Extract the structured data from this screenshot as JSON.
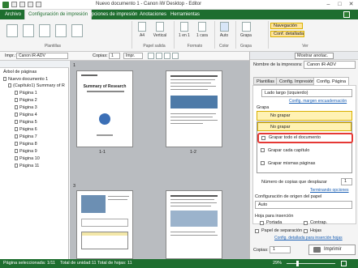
{
  "window": {
    "title": "Nuevo documento 1 - Canon iW Desktop - Editor"
  },
  "ribbon_tabs": [
    "Archivo",
    "Configuración de impresión",
    "Opciones de impresión",
    "Anotaciones",
    "Herramientas"
  ],
  "ribbon": {
    "plantillas_label": "Plantillas",
    "papel_salida_label": "Papel salida",
    "formato_label": "Formato",
    "color_label": "Color",
    "grapa_label": "Grapa",
    "ver_label": "Ver",
    "size_value": "A4",
    "orientation_value": "Vertical",
    "pages_per_sheet": "1 en 1",
    "sides": "1 cara",
    "color_value": "Auto",
    "grapa_value": "Grapa",
    "nav_button": "Navegación",
    "conf_detallada_button": "Conf. detallada",
    "mostrar_anotac_button": "Mostrar anotac."
  },
  "toolbar": {
    "printer_label": "Impr.:",
    "printer_value": "Canon iR-ADV",
    "copies_label": "Copias:",
    "copies_value": "1",
    "nav_value": "Impr."
  },
  "tree": {
    "header": "Árbol de páginas",
    "root": "Nuevo documento 1",
    "chapter": "(Capítulo1) Summary of R",
    "pages": [
      "Página 1",
      "Página 2",
      "Página 3",
      "Página 4",
      "Página 5",
      "Página 6",
      "Página 7",
      "Página 8",
      "Página 9",
      "Página 10",
      "Página 11"
    ]
  },
  "viewer": {
    "chapter_number": "1",
    "page_labels": [
      "1-1",
      "1-2"
    ],
    "second_row_number": "3",
    "page1_title": "Summary of Research"
  },
  "panel": {
    "printer_label": "Nombre de la impresora:",
    "printer_value": "Canon iR-ADV",
    "tabs": [
      "Plantillas",
      "Config. Impresión",
      "Config. Página"
    ],
    "binding_value": "Lado largo (izquierdo)",
    "margin_link": "Config. margen encuadernación",
    "grapa_label": "Grapa",
    "no_grapar_selected": "No grapar",
    "options": [
      "No grapar",
      "Grapar todo el documento",
      "Grapar cada capítulo",
      "Grapar mismas páginas"
    ],
    "copies_shift_label": "Número de copias que desplazar",
    "copies_shift_value": "1",
    "terminado_link": "Terminando opciones",
    "origen_label": "Configuración de origen del papel",
    "origen_value": "Auto",
    "hojas_label": "Hoja para inserción",
    "portada_label": "Portada",
    "contrap_label": "Contrap.",
    "papel_sep_label": "Papel de separación",
    "hojas2_label": "Hojas",
    "detallada_link": "Config. detallada para inserción hojas",
    "copias_label": "Copias:",
    "copias_value": "1",
    "imprimir_button": "Imprimir"
  },
  "status": {
    "selected": "Página seleccionada: 1/11",
    "unit": "Total de unidad:11",
    "sheets": "Total de hojas: 11",
    "zoom": "29%"
  },
  "colors": {
    "brand": "#1e6e2f",
    "highlight": "#e53935",
    "selection_yellow": "#fff2b3"
  }
}
